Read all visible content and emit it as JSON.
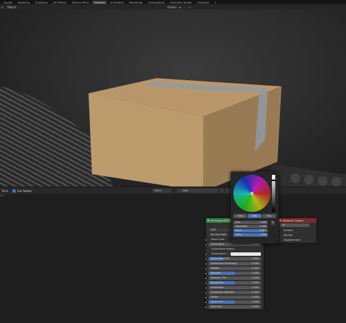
{
  "workspace_tabs": [
    "Layout",
    "Modeling",
    "Sculpting",
    "UV Editing",
    "Texture Paint",
    "Shading",
    "Animation",
    "Rendering",
    "Compositing",
    "Geometry Nodes",
    "Scripting",
    "+"
  ],
  "active_workspace_index": 5,
  "viewport_header": {
    "left": [
      "e",
      "Object"
    ],
    "center": [
      "Global",
      "⇋",
      "◦",
      "∿"
    ]
  },
  "node_header": {
    "left_label": "Tools",
    "use_nodes_label": "Use Nodes",
    "slot_label": "Slot 1",
    "material_name": "tape",
    "side_label": "w"
  },
  "principled_node": {
    "title": "Principled BSDF",
    "header_color": "#2f7a3b",
    "rows": [
      {
        "name": "BSDF",
        "type": "output"
      },
      {
        "name": "GGX",
        "type": "dropdown"
      },
      {
        "name": "Random Walk",
        "type": "dropdown"
      },
      {
        "name": "Base Color",
        "type": "socket",
        "socket_color": "#c7c729"
      },
      {
        "name": "Subsurface",
        "value": "0.000",
        "fill": 0,
        "socket_color": "#a1a1a1"
      },
      {
        "name": "Subsurface Radius",
        "type": "socket",
        "socket_color": "#6363c7"
      },
      {
        "name": "Subsurface C...",
        "type": "color",
        "swatch": "#e8e8e8",
        "socket_color": "#c7c729"
      },
      {
        "name": "Subsurface IOR",
        "value": "1.400",
        "fill": 0.28,
        "socket_color": "#a1a1a1"
      },
      {
        "name": "Subsurface Anisotropy",
        "value": "0.000",
        "fill": 0,
        "socket_color": "#a1a1a1"
      },
      {
        "name": "Metallic",
        "value": "0.000",
        "fill": 0,
        "socket_color": "#a1a1a1"
      },
      {
        "name": "Specular",
        "value": "0.500",
        "fill": 0.5,
        "socket_color": "#a1a1a1"
      },
      {
        "name": "Specular Tint",
        "value": "0.000",
        "fill": 0,
        "socket_color": "#a1a1a1"
      },
      {
        "name": "Roughness",
        "value": "0.500",
        "fill": 0.5,
        "socket_color": "#a1a1a1"
      },
      {
        "name": "Anisotropic",
        "value": "0.000",
        "fill": 0,
        "socket_color": "#a1a1a1"
      },
      {
        "name": "Anisotropic Rotation",
        "value": "0.000",
        "fill": 0,
        "socket_color": "#a1a1a1"
      },
      {
        "name": "Sheen",
        "value": "0.000",
        "fill": 0,
        "socket_color": "#a1a1a1"
      },
      {
        "name": "Sheen Tint",
        "value": "0.500",
        "fill": 0.5,
        "socket_color": "#a1a1a1"
      },
      {
        "name": "Clearcoat",
        "value": "0.000",
        "fill": 0,
        "socket_color": "#a1a1a1"
      }
    ]
  },
  "material_output_node": {
    "title": "Material Output",
    "header_color": "#7a2a2a",
    "target": "All",
    "inputs": [
      {
        "name": "Surface",
        "socket_color": "#4ec97a"
      },
      {
        "name": "Volume",
        "socket_color": "#4ec97a"
      },
      {
        "name": "Displacement",
        "socket_color": "#6363c7"
      }
    ]
  },
  "color_picker": {
    "modes": [
      "RGB",
      "HSV",
      "Hex"
    ],
    "active_mode": "HSV",
    "value_level": 0.86,
    "fields": [
      {
        "name": "Hue",
        "value": "0.000",
        "fill": 0
      },
      {
        "name": "Saturation",
        "value": "0.000",
        "fill": 0
      },
      {
        "name": "Value",
        "value": "0.881",
        "fill": 0.881
      },
      {
        "name": "Alpha",
        "value": "1.000",
        "fill": 1
      }
    ],
    "eyedropper_icon": "eyedropper-icon"
  }
}
